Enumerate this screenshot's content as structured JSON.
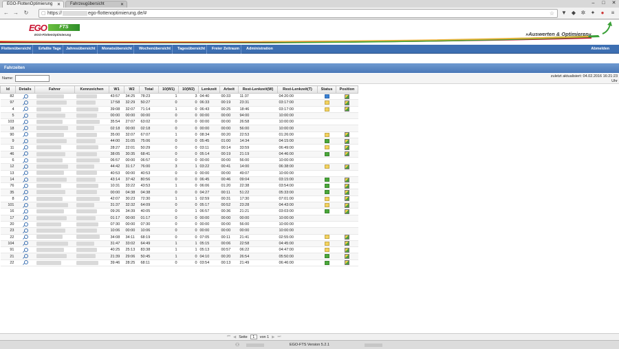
{
  "browser": {
    "tabs": [
      {
        "label": "EGO-FlottenOptimierung"
      },
      {
        "label": "Fahrzeugübersicht"
      }
    ],
    "url_prefix": "https://",
    "url_suffix": "ego-flottenoptimierung.de/#"
  },
  "header": {
    "logo_ego": "EGO",
    "logo_fts": "FTS",
    "logo_sub": "EGO-FlottenOptimierung",
    "slogan": "»Auswerten & Optimieren«"
  },
  "menu": {
    "items": [
      {
        "label": "Flottenübersicht"
      },
      {
        "label": "Erfaßte Tage"
      },
      {
        "label": "Jahresübersicht"
      },
      {
        "label": "Monatsübersicht"
      },
      {
        "label": "Wochenübersicht"
      },
      {
        "label": "Tagesübersicht"
      },
      {
        "label": "Freier Zeitraum"
      },
      {
        "label": "Administration"
      }
    ],
    "logout": "Abmelden"
  },
  "panel": {
    "title": "Fahrzeiten",
    "filter_label": "Name:",
    "filter_value": "",
    "updated_line1": "zuletzt aktualisiert: 04.02.2016 16:21:23",
    "updated_line2": "Uhr"
  },
  "table": {
    "headers": [
      "Id",
      "Details",
      "Fahrer",
      "Kennzeichen",
      "W1",
      "W2",
      "Total",
      "10(W1)",
      "10(W2)",
      "Lenkzeit",
      "Arbeit",
      "Rest-Lenkzeit(W)",
      "Rest-Lenkzeit(T)",
      "Status",
      "Position"
    ],
    "rows": [
      [
        "82",
        "43:57",
        "34:25",
        "78:23",
        "1",
        "3",
        "04:40",
        "00:33",
        "11:37",
        "04:20:00",
        "blue",
        true
      ],
      [
        "97",
        "17:58",
        "32:29",
        "50:27",
        "0",
        "0",
        "06:33",
        "00:19",
        "23:31",
        "03:17:00",
        "yellow",
        true
      ],
      [
        "4",
        "39:08",
        "32:07",
        "71:14",
        "1",
        "0",
        "06:43",
        "00:25",
        "18:46",
        "03:17:00",
        "yellow",
        true
      ],
      [
        "5",
        "00:00",
        "00:00",
        "00:00",
        "0",
        "0",
        "00:00",
        "00:00",
        "94:00",
        "10:00:00",
        "",
        false
      ],
      [
        "103",
        "35:54",
        "27:07",
        "63:02",
        "0",
        "0",
        "00:00",
        "00:00",
        "26:58",
        "10:00:00",
        "",
        false
      ],
      [
        "18",
        "02:18",
        "00:00",
        "02:18",
        "0",
        "0",
        "00:00",
        "00:00",
        "56:00",
        "10:00:00",
        "",
        false
      ],
      [
        "90",
        "35:00",
        "32:07",
        "67:07",
        "1",
        "0",
        "08:34",
        "00:20",
        "22:53",
        "01:26:00",
        "yellow",
        true
      ],
      [
        "9",
        "44:00",
        "31:05",
        "75:06",
        "0",
        "0",
        "05:45",
        "01:00",
        "14:34",
        "04:15:00",
        "green",
        true
      ],
      [
        "11",
        "28:27",
        "22:01",
        "50:29",
        "0",
        "0",
        "03:11",
        "00:14",
        "33:59",
        "06:49:00",
        "yellow",
        true
      ],
      [
        "46",
        "38:05",
        "30:35",
        "68:41",
        "0",
        "0",
        "05:14",
        "00:19",
        "21:19",
        "04:46:00",
        "green",
        true
      ],
      [
        "6",
        "06:57",
        "00:00",
        "06:57",
        "0",
        "0",
        "00:00",
        "00:00",
        "56:00",
        "10:00:00",
        "",
        false
      ],
      [
        "12",
        "44:42",
        "31:17",
        "76:00",
        "3",
        "1",
        "03:22",
        "00:41",
        "14:00",
        "06:38:00",
        "yellow",
        true
      ],
      [
        "13",
        "40:53",
        "00:00",
        "40:53",
        "0",
        "0",
        "00:00",
        "00:00",
        "49:07",
        "10:00:00",
        "",
        false
      ],
      [
        "14",
        "43:14",
        "37:42",
        "80:56",
        "0",
        "0",
        "06:45",
        "00:46",
        "09:04",
        "03:15:00",
        "green",
        true
      ],
      [
        "76",
        "10:31",
        "33:22",
        "43:53",
        "1",
        "0",
        "06:06",
        "01:20",
        "22:38",
        "03:54:00",
        "green",
        true
      ],
      [
        "35",
        "00:00",
        "04:38",
        "04:38",
        "0",
        "0",
        "04:27",
        "00:11",
        "51:22",
        "05:33:00",
        "green",
        true
      ],
      [
        "8",
        "42:07",
        "30:23",
        "72:30",
        "1",
        "1",
        "02:59",
        "00:31",
        "17:30",
        "07:01:00",
        "yellow",
        true
      ],
      [
        "101",
        "31:37",
        "32:32",
        "64:09",
        "0",
        "0",
        "05:17",
        "00:52",
        "23:28",
        "04:43:00",
        "yellow",
        true
      ],
      [
        "16",
        "09:26",
        "34:39",
        "40:05",
        "0",
        "1",
        "06:57",
        "00:36",
        "21:21",
        "03:03:00",
        "green",
        true
      ],
      [
        "17",
        "01:17",
        "00:00",
        "01:17",
        "0",
        "0",
        "00:00",
        "00:00",
        "00:00",
        "10:00:00",
        "",
        false
      ],
      [
        "20",
        "07:30",
        "00:00",
        "07:30",
        "0",
        "0",
        "00:00",
        "00:00",
        "56:00",
        "10:00:00",
        "",
        false
      ],
      [
        "23",
        "10:06",
        "00:00",
        "10:06",
        "0",
        "0",
        "00:00",
        "00:00",
        "00:00",
        "10:00:00",
        "",
        false
      ],
      [
        "22",
        "34:08",
        "34:11",
        "68:19",
        "0",
        "0",
        "07:05",
        "00:11",
        "21:41",
        "02:55:00",
        "yellow",
        true
      ],
      [
        "104",
        "31:47",
        "33:02",
        "64:49",
        "1",
        "1",
        "05:15",
        "00:06",
        "22:58",
        "04:45:00",
        "yellow",
        true
      ],
      [
        "91",
        "40:25",
        "25:13",
        "83:38",
        "1",
        "1",
        "05:13",
        "00:57",
        "06:22",
        "04:47:00",
        "yellow",
        true
      ],
      [
        "21",
        "21:39",
        "29:06",
        "50:45",
        "1",
        "0",
        "04:10",
        "00:20",
        "26:54",
        "05:50:00",
        "green",
        true
      ],
      [
        "22",
        "39:46",
        "28:25",
        "68:11",
        "0",
        "0",
        "03:54",
        "00:13",
        "21:49",
        "06:46:00",
        "green",
        true
      ]
    ]
  },
  "status_colors": {
    "blue": "#3b82d6",
    "yellow": "#f4d35e",
    "green": "#4aa83a"
  },
  "pager": {
    "seite": "Seite",
    "page": "1",
    "von": "von 1"
  },
  "footer": {
    "version": "EGO-FTS Version 5.2.1"
  }
}
